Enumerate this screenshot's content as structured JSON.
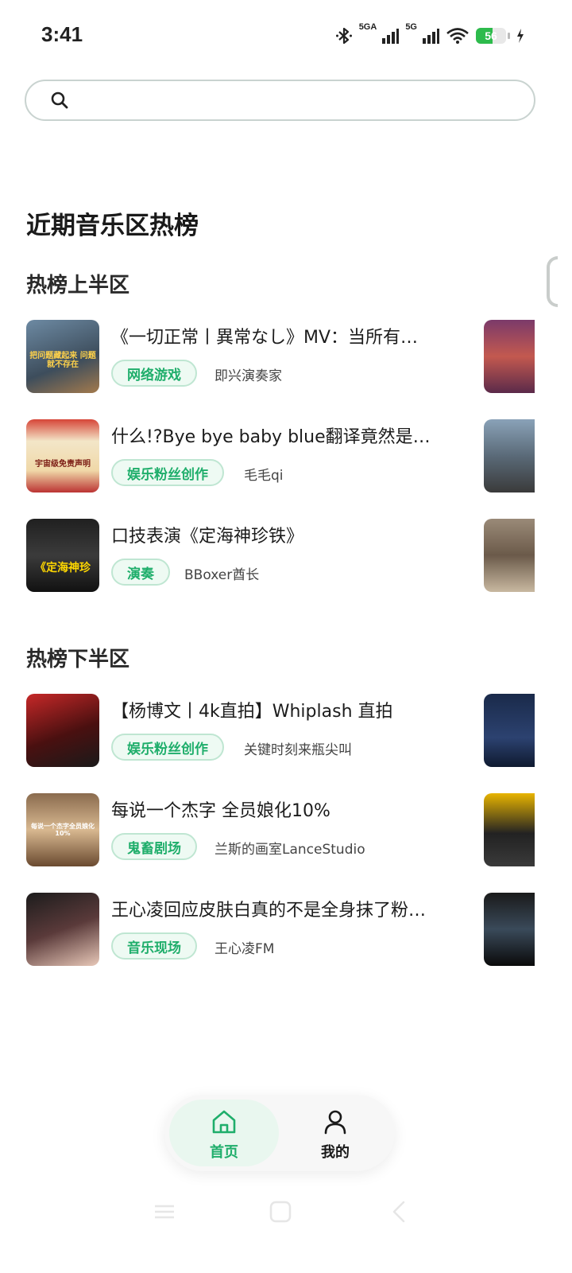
{
  "status_bar": {
    "time": "3:41",
    "network_1": "5GA",
    "network_2": "5G",
    "battery": "56",
    "battery_level": 0.56
  },
  "search": {
    "placeholder": ""
  },
  "page_title": "近期音乐区热榜",
  "sections": [
    {
      "title": "热榜上半区",
      "items": [
        {
          "title": "《一切正常丨異常なし》MV：当所有…",
          "tag": "网络游戏",
          "author": "即兴演奏家",
          "thumb_text": "把问题藏起来 问题就不存在",
          "thumb_color": "#5a6a7a"
        },
        {
          "title": "什么!?Bye bye baby blue翻译竟然是错…",
          "tag": "娱乐粉丝创作",
          "author": "毛毛qi",
          "thumb_text": "宇宙级免责声明",
          "thumb_color": "#c0392b"
        },
        {
          "title": "口技表演《定海神珍铁》",
          "tag": "演奏",
          "author": "BBoxer酋长",
          "thumb_text": "《定海神珍",
          "thumb_color": "#1b1b1b"
        }
      ]
    },
    {
      "title": "热榜下半区",
      "items": [
        {
          "title": "【杨博文丨4k直拍】Whiplash 直拍",
          "tag": "娱乐粉丝创作",
          "author": "关键时刻来瓶尖叫",
          "thumb_text": "",
          "thumb_color": "#8e1b1b"
        },
        {
          "title": "每说一个杰字 全员娘化10%",
          "tag": "鬼畜剧场",
          "author": "兰斯的画室LanceStudio",
          "thumb_text": "每说一个杰字全员娘化10%",
          "thumb_color": "#8a6b4e"
        },
        {
          "title": "王心凌回应皮肤白真的不是全身抹了粉…",
          "tag": "音乐现场",
          "author": "王心凌FM",
          "thumb_text": "",
          "thumb_color": "#3a2a2a"
        }
      ]
    }
  ],
  "bottom_nav": {
    "home_label": "首页",
    "mine_label": "我的"
  },
  "colors": {
    "accent": "#1fae6b",
    "tag_bg": "#eefaf3",
    "tag_border": "#bfe6d2"
  }
}
